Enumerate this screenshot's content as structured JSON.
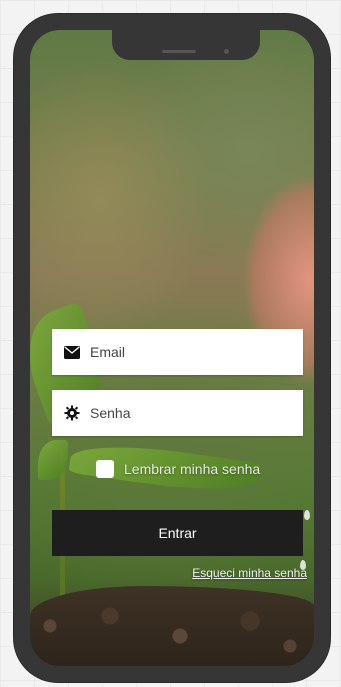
{
  "login_form": {
    "email_placeholder": "Email",
    "password_placeholder": "Senha",
    "remember_label": "Lembrar minha senha",
    "remember_checked": false,
    "submit_label": "Entrar",
    "forgot_link": "Esqueci minha senha"
  },
  "icons": {
    "email": "envelope-icon",
    "password": "gear-icon"
  },
  "colors": {
    "button_bg": "#1e1e1e",
    "field_bg": "#ffffff",
    "phone_frame": "#363636"
  }
}
